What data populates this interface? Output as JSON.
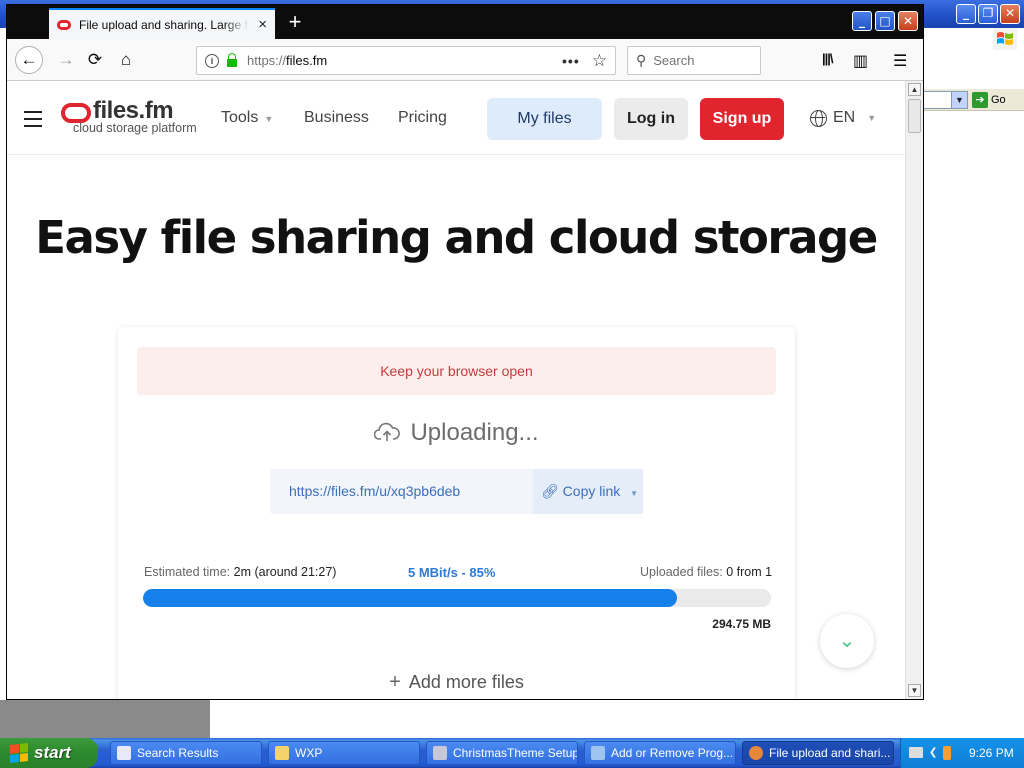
{
  "desktop": {
    "background_window": {
      "go_label": "Go"
    },
    "taskbar": {
      "start_label": "start",
      "tasks": [
        {
          "label": "Search Results",
          "icon": "search-results-icon"
        },
        {
          "label": "WXP",
          "icon": "folder-icon"
        },
        {
          "label": "ChristmasTheme Setup",
          "icon": "setup-icon"
        },
        {
          "label": "Add or Remove Prog...",
          "icon": "add-remove-programs-icon"
        },
        {
          "label": "File upload and shari...",
          "icon": "firefox-icon"
        }
      ],
      "clock": "9:26 PM"
    }
  },
  "browser": {
    "tab": {
      "title": "File upload and sharing. Large file storage",
      "close": "×"
    },
    "new_tab": "+",
    "window_controls": {
      "minimize": "_",
      "maximize": "□",
      "close": "✕"
    },
    "nav": {
      "back": "←",
      "forward": "→",
      "reload": "⟳",
      "home": "⌂"
    },
    "url": {
      "scheme": "https://",
      "host": "files.fm"
    },
    "url_actions": {
      "more": "•••",
      "bookmark": "☆"
    },
    "search_placeholder": "Search",
    "toolbar_icons": {
      "library": "|||\\",
      "sidebar": "▥",
      "menu": "☰"
    }
  },
  "site": {
    "logo": {
      "name_part1": "files",
      "name_part2": ".fm",
      "tagline": "cloud storage platform"
    },
    "nav": {
      "tools": "Tools",
      "business": "Business",
      "pricing": "Pricing"
    },
    "buttons": {
      "my_files": "My files",
      "log_in": "Log in",
      "sign_up": "Sign up"
    },
    "language": "EN",
    "hero_title": "Easy file sharing and cloud storage",
    "upload": {
      "alert": "Keep your browser open",
      "status": "Uploading...",
      "share_link": "https://files.fm/u/xq3pb6deb",
      "copy_link_label": "Copy link",
      "estimated_label": "Estimated time:",
      "estimated_value": "2m (around 21:27)",
      "speed": "5 MBit/s - 85%",
      "uploaded_label": "Uploaded files:",
      "uploaded_value": "0 from 1",
      "progress_percent": 85,
      "total_size": "294.75 MB",
      "add_more": "Add more files"
    },
    "colors": {
      "brand_red": "#e0252f",
      "progress_blue": "#1680ea",
      "link_blue": "#3b6fb6"
    }
  }
}
